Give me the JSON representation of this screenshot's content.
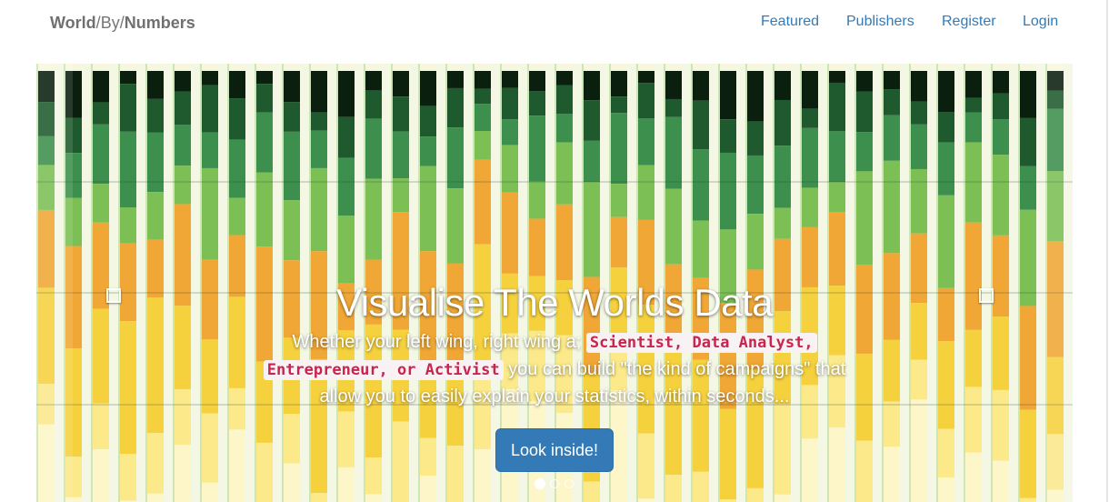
{
  "navbar": {
    "brand": {
      "part1": "World",
      "sep1": "/",
      "part2": "By",
      "sep2": "/",
      "part3": "Numbers"
    },
    "links": [
      {
        "label": "Featured"
      },
      {
        "label": "Publishers"
      },
      {
        "label": "Register"
      },
      {
        "label": "Login"
      }
    ]
  },
  "carousel": {
    "headline": "Visualise The Worlds Data",
    "description": {
      "intro": "Whether your left wing, right wing a; ",
      "highlight": "Scientist, Data Analyst, Entrepreneur, or Activist",
      "outro": " you can build \"the kind of campaigns\" that allow you to easily explain your statistics, within seconds..."
    },
    "button_label": "Look inside!",
    "indicator_count": 3,
    "active_indicator": 0,
    "prev_icon": "square-outline-icon",
    "next_icon": "square-outline-icon",
    "colors": {
      "button": "#337ab7",
      "link": "#337ab7",
      "highlight_text": "#c7254e",
      "highlight_bg": "#f9f2f4",
      "bar_palette": [
        "#0b1f0e",
        "#1e5a2e",
        "#3d8f4d",
        "#7cbf55",
        "#f0a735",
        "#f6d13e",
        "#fbe98a",
        "#fdf6c8"
      ]
    }
  }
}
